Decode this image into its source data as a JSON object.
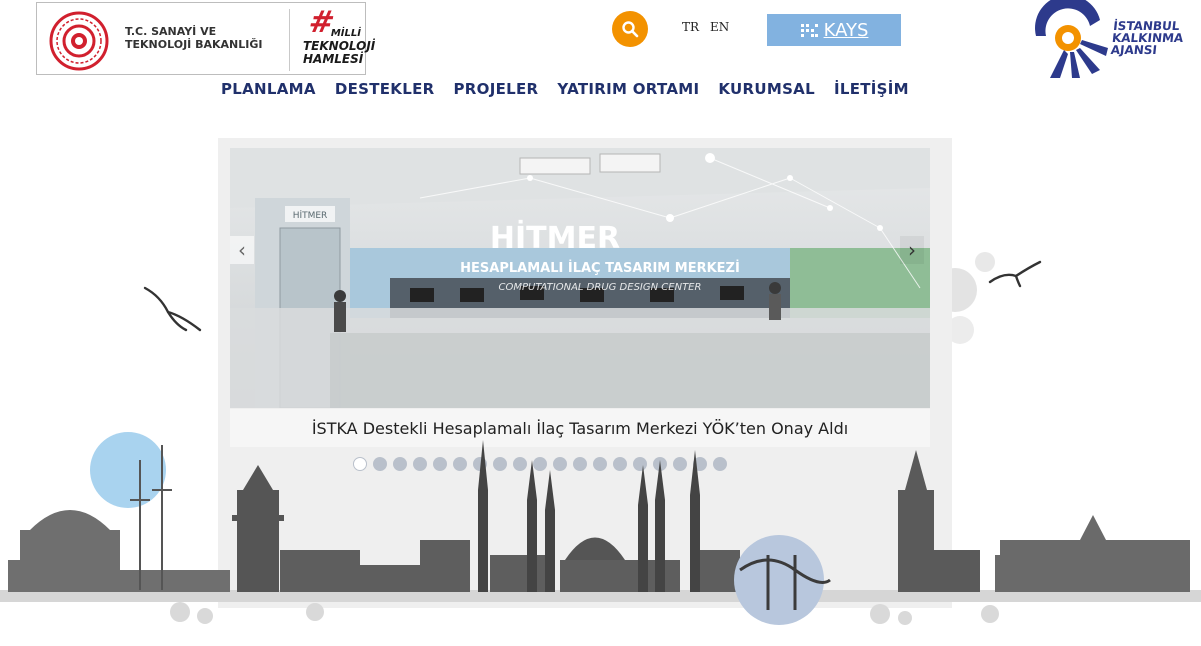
{
  "header": {
    "ministry_line1": "T.C. SANAYİ VE",
    "ministry_line2": "TEKNOLOJİ BAKANLIĞI",
    "milli_line1": "MİLLİ",
    "milli_line2": "TEKNOLOJİ",
    "milli_line3": "HAMLESİ",
    "search_icon": "search-icon",
    "lang_tr": "TR",
    "lang_en": "EN",
    "kays_label": "KAYS",
    "agency_line1": "İSTANBUL",
    "agency_line2": "KALKINMA",
    "agency_line3": "AJANSI"
  },
  "nav": {
    "items": [
      {
        "label": "PLANLAMA"
      },
      {
        "label": "DESTEKLER"
      },
      {
        "label": "PROJELER"
      },
      {
        "label": "YATIRIM ORTAMI"
      },
      {
        "label": "KURUMSAL"
      },
      {
        "label": "İLETİŞİM"
      }
    ]
  },
  "slider": {
    "caption": "İSTKA Destekli Hesaplamalı İlaç Tasarım Merkezi YÖK’ten Onay Aldı",
    "image_brand": "HİTMER",
    "image_door_sign": "HİTMER",
    "image_subtitle": "HESAPLAMALI İLAÇ TASARIM MERKEZİ",
    "image_subtitle_en": "COMPUTATIONAL DRUG DESIGN CENTER",
    "prev_arrow": "‹",
    "next_arrow": "›",
    "dot_count": 19,
    "active_dot": 0
  },
  "colors": {
    "nav_text": "#20306b",
    "search_bg": "#f39200",
    "kays_bg": "#82b2e0",
    "agency_blue": "#2d3a8c",
    "agency_orange": "#f39200",
    "dot": "#b9c0cb"
  }
}
